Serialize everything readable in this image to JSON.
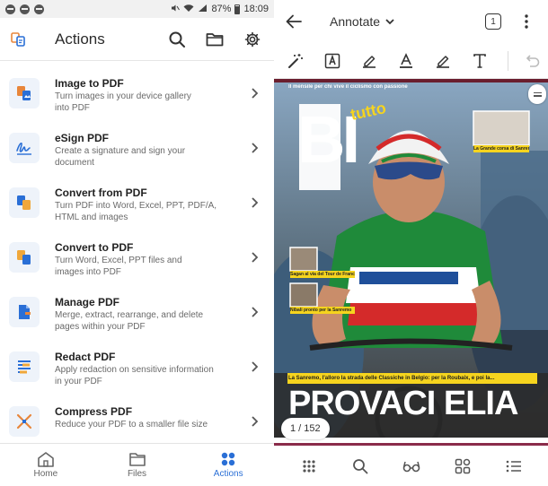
{
  "status_bar": {
    "battery": "87%",
    "time": "18:09"
  },
  "app": {
    "title": "Actions"
  },
  "actions": [
    {
      "title": "Image to PDF",
      "desc1": "Turn images in your device gallery",
      "desc2": "into PDF",
      "icon": "image-to-pdf-icon"
    },
    {
      "title": "eSign PDF",
      "desc1": "Create a signature and sign your",
      "desc2": "document",
      "icon": "esign-icon"
    },
    {
      "title": "Convert from PDF",
      "desc1": "Turn PDF into Word, Excel, PPT, PDF/A,",
      "desc2": "HTML and images",
      "icon": "convert-from-pdf-icon"
    },
    {
      "title": "Convert to PDF",
      "desc1": "Turn Word, Excel, PPT files and",
      "desc2": "images into PDF",
      "icon": "convert-to-pdf-icon"
    },
    {
      "title": "Manage PDF",
      "desc1": "Merge, extract, rearrange, and delete",
      "desc2": "pages within your PDF",
      "icon": "manage-pdf-icon"
    },
    {
      "title": "Redact PDF",
      "desc1": "Apply redaction on sensitive information",
      "desc2": "in your PDF",
      "icon": "redact-icon"
    },
    {
      "title": "Compress PDF",
      "desc1": "Reduce your PDF to a smaller file size",
      "desc2": "",
      "icon": "compress-icon"
    }
  ],
  "bottom_nav": {
    "home": "Home",
    "files": "Files",
    "actions": "Actions",
    "active": "actions"
  },
  "viewer": {
    "mode": "Annotate",
    "page_indicator": "1",
    "page_counter": "1 / 152"
  },
  "magazine": {
    "masthead": "BI",
    "masthead_tag": "tutto",
    "headline": "PROVACI ELIA",
    "subheadline": "La Sanremo, l'alloro la strada delle Classiche in Belgio: per la Roubaix, e poi la...",
    "banner": "Il mensile per chi vive il ciclismo con passione",
    "left_caption_1": "Sagan al via del Tour de France",
    "left_caption_2": "Nibali pronto per la Sanremo",
    "right_caption": "La Grande corsa di Sanremo"
  },
  "colors": {
    "accent": "#2a6fd6",
    "headline": "#ffffff",
    "jersey_green": "#1f8a3a",
    "jersey_red": "#d42a2a",
    "banner_yellow": "#f6d41e",
    "page_line": "#8a2b4a"
  }
}
